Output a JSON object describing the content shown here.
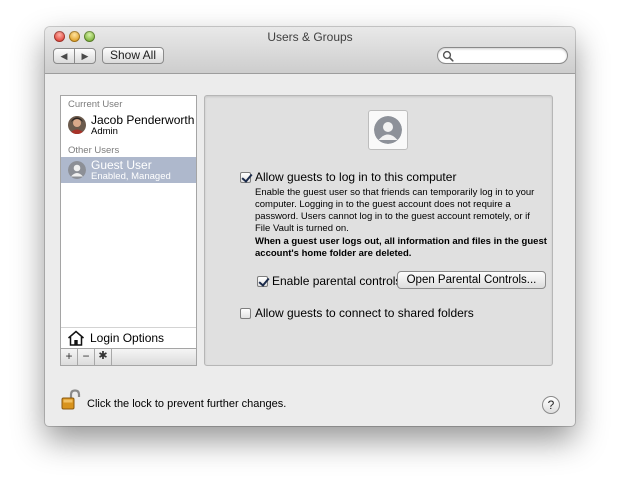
{
  "window": {
    "title": "Users & Groups"
  },
  "toolbar": {
    "back_icon": "◀",
    "forward_icon": "▶",
    "show_all_label": "Show All",
    "search": {
      "value": "",
      "placeholder": ""
    }
  },
  "sidebar": {
    "current_users_header": "Current User",
    "current_user": {
      "name": "Jacob Penderworth",
      "role": "Admin"
    },
    "other_users_header": "Other Users",
    "guest_user": {
      "name": "Guest User",
      "status": "Enabled, Managed",
      "selected": true
    },
    "login_options_label": "Login Options",
    "add_button": "+",
    "remove_button": "−",
    "gear_button": "✱"
  },
  "guest_pane": {
    "allow_guests_label": "Allow guests to log in to this computer",
    "allow_guests_checked": true,
    "description": "Enable the guest user so that friends can temporarily log in to your computer. Logging in to the guest account does not require a password. Users cannot log in to the guest account remotely, or if File Vault is turned on.",
    "warning": "When a guest user logs out, all information and files in the guest account's home folder are deleted.",
    "parental_controls_label": "Enable parental controls",
    "parental_controls_checked": true,
    "open_parental_controls_button": "Open Parental Controls...",
    "shared_folders_label": "Allow guests to connect to shared folders",
    "shared_folders_checked": false
  },
  "footer": {
    "lock_text": "Click the lock to prevent further changes.",
    "help_label": "?"
  }
}
